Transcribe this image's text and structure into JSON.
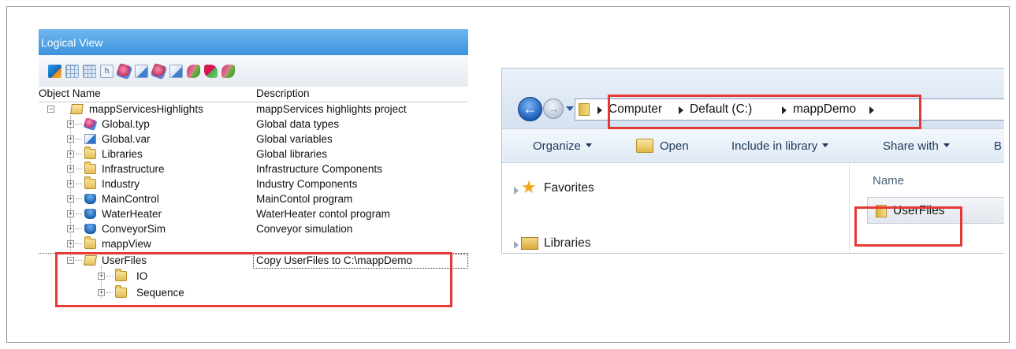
{
  "logical_view": {
    "title": "Logical View",
    "toolbar_icons": [
      "cube-icon",
      "table-icon",
      "grid-icon",
      "help-icon",
      "data-type-icon",
      "variable-icon",
      "library-icon",
      "program-icon",
      "link-icon",
      "refresh-icon",
      "remove-icon"
    ],
    "columns": {
      "name": "Object Name",
      "description": "Description"
    },
    "rows": [
      {
        "name": "mappServicesHighlights",
        "description": "mappServices highlights project",
        "icon": "folder-open-icon"
      },
      {
        "name": "Global.typ",
        "description": "Global data types",
        "icon": "data-type-icon"
      },
      {
        "name": "Global.var",
        "description": "Global variables",
        "icon": "variable-icon"
      },
      {
        "name": "Libraries",
        "description": "Global libraries",
        "icon": "folder-icon"
      },
      {
        "name": "Infrastructure",
        "description": "Infrastructure Components",
        "icon": "folder-icon"
      },
      {
        "name": "Industry",
        "description": "Industry Components",
        "icon": "folder-icon"
      },
      {
        "name": "MainControl",
        "description": "MainContol program",
        "icon": "program-icon"
      },
      {
        "name": "WaterHeater",
        "description": "WaterHeater contol program",
        "icon": "program-icon"
      },
      {
        "name": "ConveyorSim",
        "description": "Conveyor simulation",
        "icon": "program-icon"
      },
      {
        "name": "mappView",
        "description": "",
        "icon": "folder-icon"
      },
      {
        "name": "UserFiles",
        "description": "Copy UserFiles to C:\\mappDemo",
        "icon": "folder-open-icon"
      },
      {
        "name": "IO",
        "description": "",
        "icon": "folder-icon"
      },
      {
        "name": "Sequence",
        "description": "",
        "icon": "folder-icon"
      }
    ]
  },
  "explorer": {
    "breadcrumb": [
      "Computer",
      "Default (C:)",
      "mappDemo"
    ],
    "commands": {
      "organize": "Organize",
      "open": "Open",
      "include": "Include in library",
      "share": "Share with",
      "burn": "B"
    },
    "nav": {
      "favorites": "Favorites",
      "libraries": "Libraries"
    },
    "column_name": "Name",
    "file": "UserFiles"
  },
  "colors": {
    "highlight": "#e53935",
    "titlebar": "#3d92dd"
  }
}
